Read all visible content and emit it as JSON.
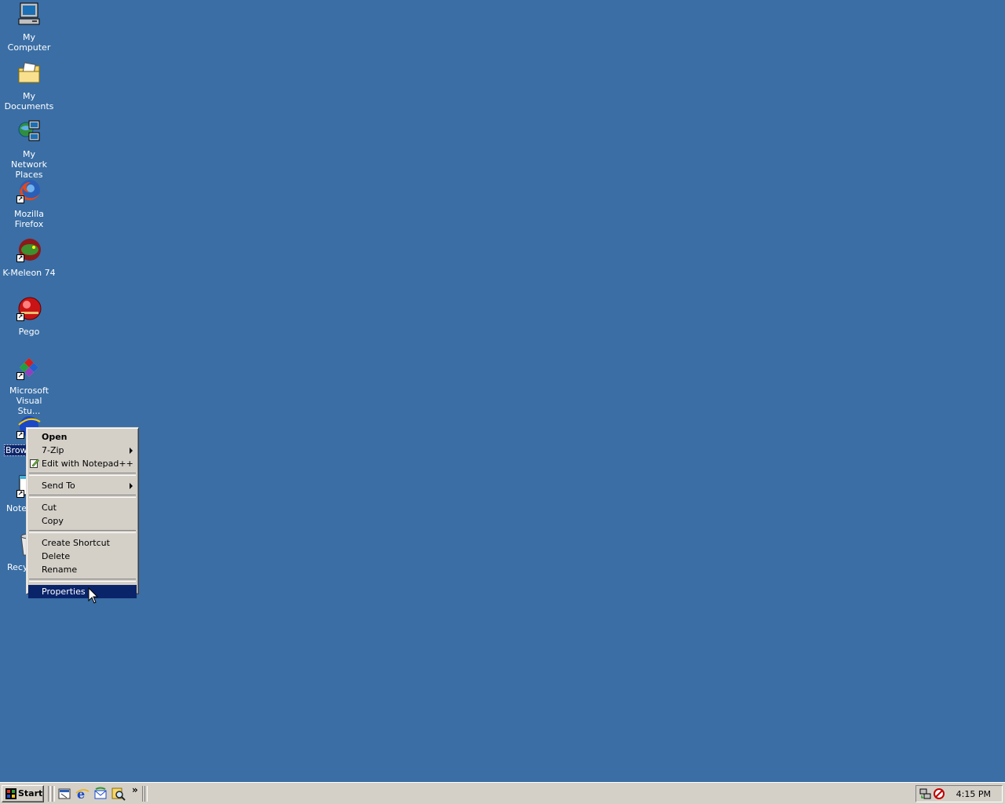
{
  "desktop": {
    "background_color": "#3a6ea5",
    "icons": [
      {
        "label": "My Computer",
        "icon": "my-computer-icon"
      },
      {
        "label": "My Documents",
        "icon": "my-documents-icon"
      },
      {
        "label": "My Network Places",
        "icon": "network-places-icon"
      },
      {
        "label": "Mozilla Firefox",
        "icon": "firefox-icon"
      },
      {
        "label": "K-Meleon 74",
        "icon": "k-meleon-icon"
      },
      {
        "label": "Pego",
        "icon": "pego-icon"
      },
      {
        "label": "Microsoft Visual Stu...",
        "icon": "visual-studio-icon"
      },
      {
        "label": "Brows",
        "icon": "browser-icon",
        "selected": true
      },
      {
        "label": "Note",
        "icon": "notepad-icon"
      },
      {
        "label": "Recy",
        "icon": "recycle-bin-icon"
      }
    ]
  },
  "context_menu": {
    "items": {
      "open": "Open",
      "zip": "7-Zip",
      "notepadpp": "Edit with Notepad++",
      "send_to": "Send To",
      "cut": "Cut",
      "copy": "Copy",
      "create_shortcut": "Create Shortcut",
      "delete": "Delete",
      "rename": "Rename",
      "properties": "Properties"
    },
    "highlighted": "Properties",
    "highlight_color": "#0a246a"
  },
  "taskbar": {
    "start_label": "Start",
    "quick_launch": [
      "show-desktop-icon",
      "internet-explorer-icon",
      "outlook-express-icon",
      "search-icon"
    ],
    "overflow": "»",
    "tray_icons": [
      "network-tray-icon",
      "antivirus-tray-icon"
    ],
    "clock": "4:15 PM"
  }
}
